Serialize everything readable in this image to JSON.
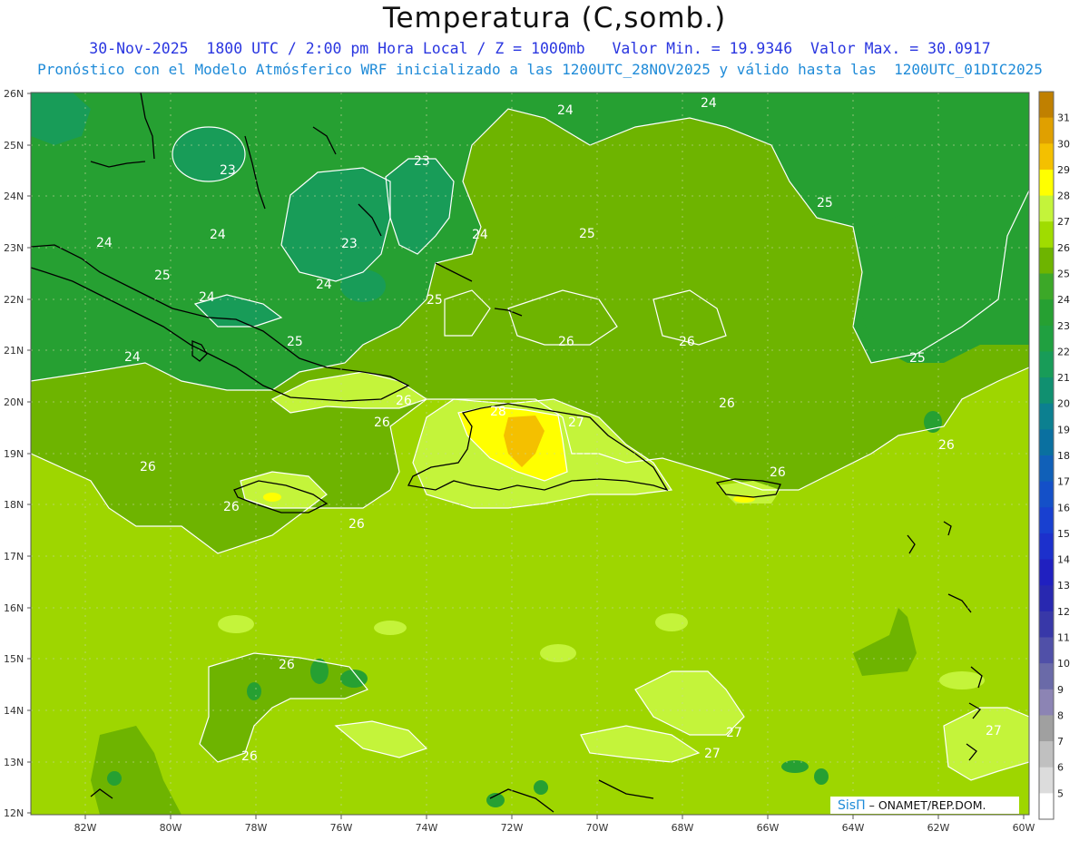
{
  "header": {
    "title": "Temperatura (C,somb.)",
    "line1": "30-Nov-2025  1800 UTC / 2:00 pm Hora Local / Z = 1000mb   Valor Min. = 19.9346  Valor Max. = 30.0917",
    "line2": "Pronóstico con el Modelo Atmósferico WRF inicializado a las 1200UTC_28NOV2025 y válido hasta las  1200UTC_01DIC2025"
  },
  "credit": {
    "logo": "SisΠ",
    "text": "– ONAMET/REP.DOM."
  },
  "axes": {
    "lat_labels": [
      "26N",
      "25N",
      "24N",
      "23N",
      "22N",
      "21N",
      "20N",
      "19N",
      "18N",
      "17N",
      "16N",
      "15N",
      "14N",
      "13N",
      "12N"
    ],
    "lon_labels": [
      "82W",
      "80W",
      "78W",
      "76W",
      "74W",
      "72W",
      "70W",
      "68W",
      "66W",
      "64W",
      "62W",
      "60W"
    ]
  },
  "colorbar": {
    "labels": [
      "31",
      "30",
      "29",
      "28",
      "27",
      "26",
      "25",
      "24",
      "23",
      "22",
      "21",
      "20",
      "19",
      "18",
      "17",
      "16",
      "15",
      "14",
      "13",
      "12",
      "11",
      "10",
      "9",
      "8",
      "7",
      "6",
      "5"
    ],
    "colors": [
      "#c08000",
      "#e0a000",
      "#f4c000",
      "#ffff00",
      "#c4f43a",
      "#a0dc00",
      "#6eb400",
      "#3ca828",
      "#26a032",
      "#20a040",
      "#189c58",
      "#109070",
      "#0c8090",
      "#0a70a0",
      "#1060b8",
      "#1450c8",
      "#1840d0",
      "#1c30cc",
      "#2020c0",
      "#2828b0",
      "#3838a8",
      "#5050a8",
      "#6a6aa8",
      "#8c84b4",
      "#a0a0a0",
      "#c0c0c0",
      "#dcdcdc",
      "#ffffff"
    ]
  },
  "contour_labels": [
    "24",
    "24",
    "23",
    "23",
    "24",
    "23",
    "24",
    "24",
    "24",
    "25",
    "25",
    "25",
    "24",
    "25",
    "26",
    "26",
    "26",
    "26",
    "26",
    "26",
    "26",
    "26",
    "26",
    "26",
    "26",
    "27",
    "27",
    "27",
    "27",
    "26",
    "25",
    "25",
    "28",
    "24"
  ],
  "colors": {
    "c23": "#189c58",
    "c24": "#26a032",
    "c25": "#6eb400",
    "c26": "#9ed600",
    "c27": "#c4f43a",
    "c28": "#ffff00",
    "c29": "#f4c000",
    "coast": "#000000",
    "contour": "#ffffff",
    "grid": "#cfe8a8",
    "axis_text": "#333333"
  }
}
